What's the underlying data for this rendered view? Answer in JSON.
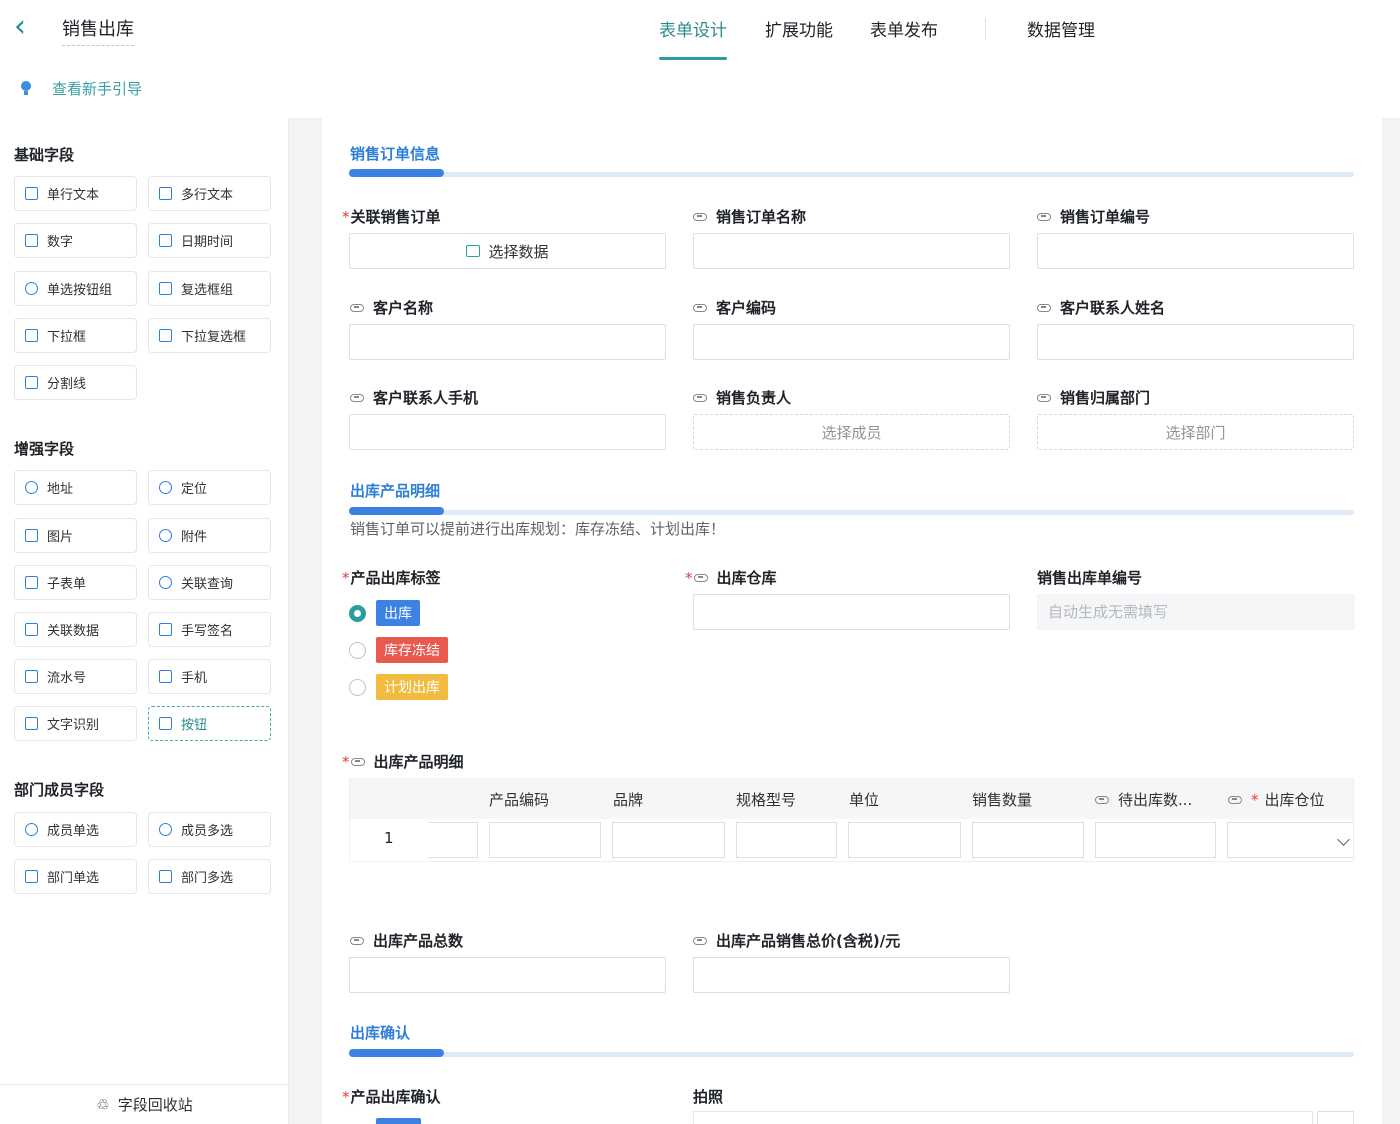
{
  "header": {
    "back_icon": "chevron-left-icon",
    "title": "销售出库",
    "guide_label": "查看新手引导",
    "tabs": [
      {
        "label": "表单设计"
      },
      {
        "label": "扩展功能"
      },
      {
        "label": "表单发布"
      },
      {
        "label": "数据管理"
      }
    ]
  },
  "sidebar": {
    "basic_title": "基础字段",
    "basic": [
      "单行文本",
      "多行文本",
      "数字",
      "日期时间",
      "单选按钮组",
      "复选框组",
      "下拉框",
      "下拉复选框",
      "分割线"
    ],
    "enhanced_title": "增强字段",
    "enhanced": [
      "地址",
      "定位",
      "图片",
      "附件",
      "子表单",
      "关联查询",
      "关联数据",
      "手写签名",
      "流水号",
      "手机",
      "文字识别",
      "按钮"
    ],
    "dept_title": "部门成员字段",
    "dept": [
      "成员单选",
      "成员多选",
      "部门单选",
      "部门多选"
    ],
    "recycle": "字段回收站"
  },
  "form": {
    "sec1": "销售订单信息",
    "f_order": "关联销售订单",
    "select_data": "选择数据",
    "f_order_name": "销售订单名称",
    "f_order_no": "销售订单编号",
    "f_cust_name": "客户名称",
    "f_cust_code": "客户编码",
    "f_contact": "客户联系人姓名",
    "f_phone": "客户联系人手机",
    "f_owner": "销售负责人",
    "select_member": "选择成员",
    "f_dept": "销售归属部门",
    "select_dept": "选择部门",
    "sec2": "出库产品明细",
    "hint": "销售订单可以提前进行出库规划：库存冻结、计划出库！",
    "f_tag": "产品出库标签",
    "tag_options": [
      {
        "label": "出库",
        "color": "#3b82e3"
      },
      {
        "label": "库存冻结",
        "color": "#e85a4f"
      },
      {
        "label": "计划出库",
        "color": "#f0bb3e"
      }
    ],
    "f_warehouse": "出库仓库",
    "f_out_no": "销售出库单编号",
    "out_no_placeholder": "自动生成无需填写",
    "f_detail": "出库产品明细",
    "table_cols": [
      "产品编码",
      "品牌",
      "规格型号",
      "单位",
      "销售数量",
      "待出库数...",
      "出库仓位"
    ],
    "row_num": "1",
    "f_total": "出库产品总数",
    "f_total_price": "出库产品销售总价(含税)/元",
    "sec3": "出库确认",
    "f_confirm": "产品出库确认",
    "f_photo": "拍照"
  }
}
